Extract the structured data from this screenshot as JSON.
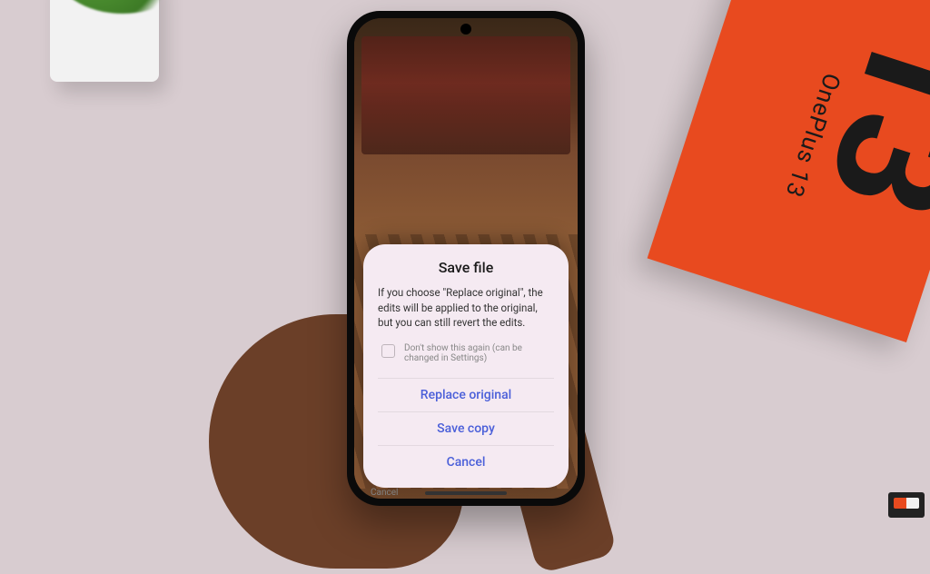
{
  "scene": {
    "box_label": "OnePlus 13",
    "box_number": "13"
  },
  "dialog": {
    "title": "Save file",
    "body": "If you choose \"Replace original\", the edits will be applied to the original, but you can still revert the edits.",
    "dont_show_label": "Don't show this again (can be changed in Settings)",
    "btn_replace": "Replace original",
    "btn_save_copy": "Save copy",
    "btn_cancel": "Cancel"
  },
  "editor": {
    "cancel_label": "Cancel"
  }
}
